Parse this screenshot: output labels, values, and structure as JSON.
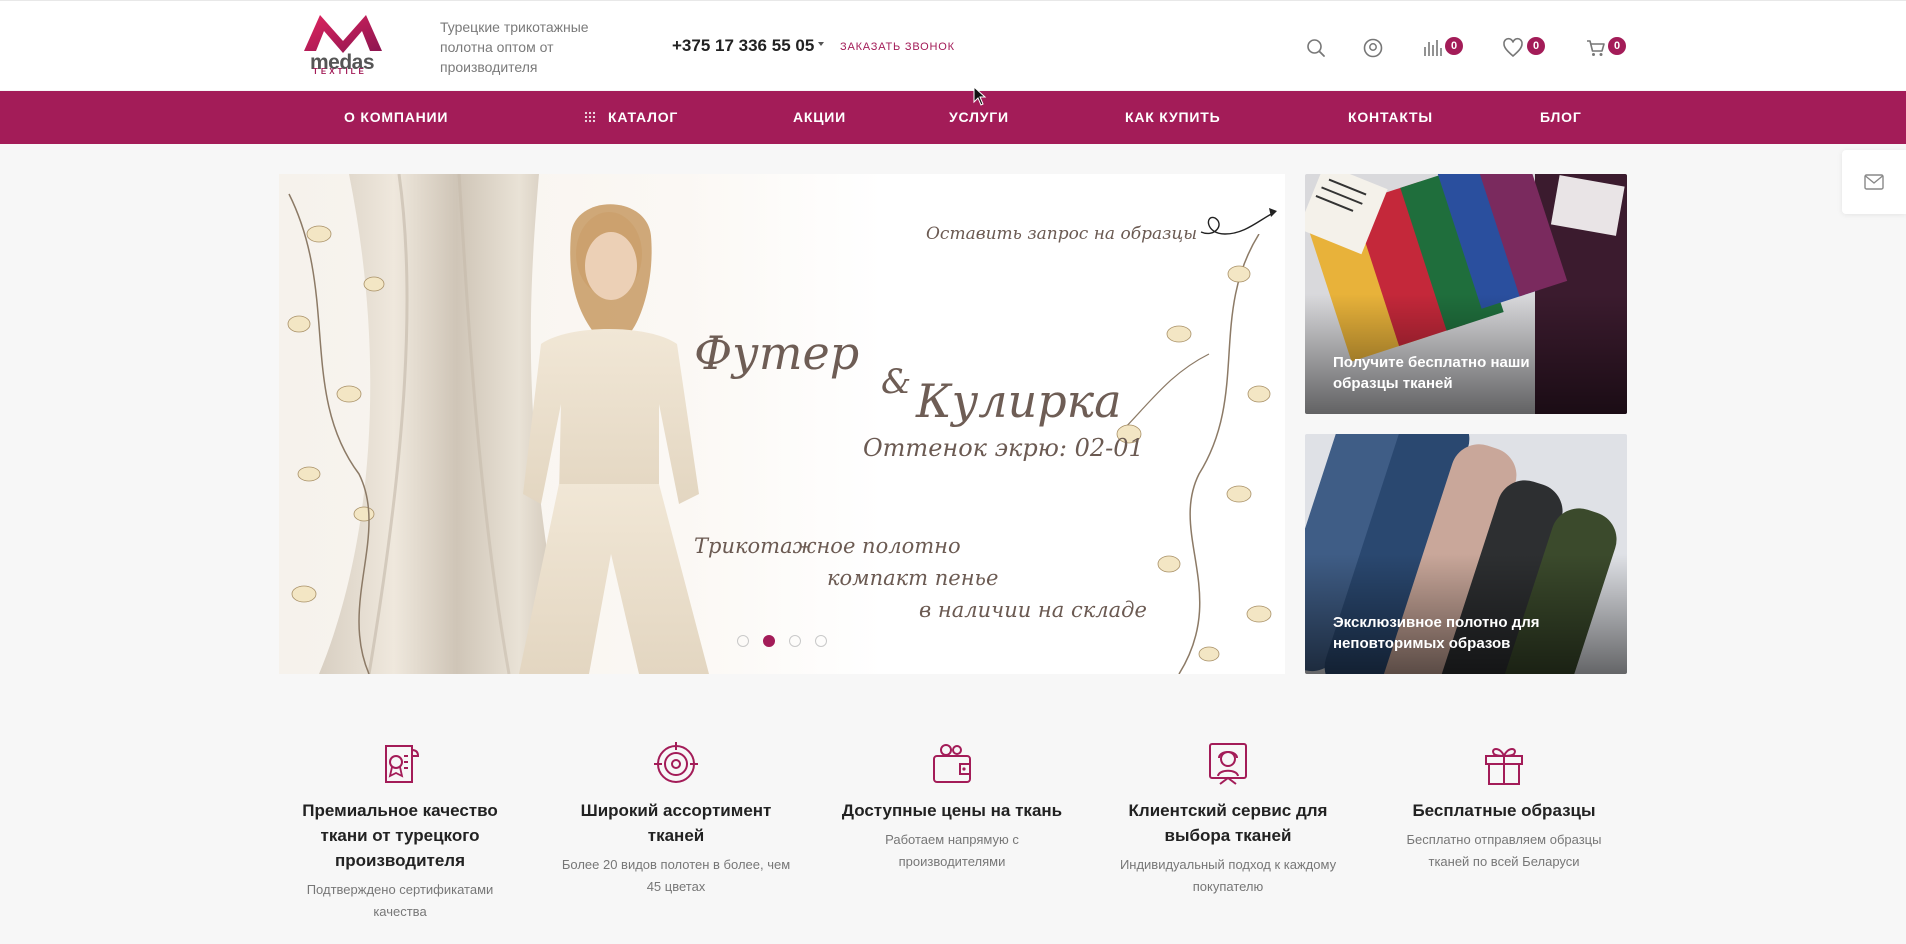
{
  "header": {
    "logo": {
      "word": "medas",
      "sub": "TEXTILE"
    },
    "tagline": "Турецкие трикотажные полотна оптом от производителя",
    "phone": "+375 17 336 55 05",
    "callback": "ЗАКАЗАТЬ ЗВОНОК",
    "icons": [
      "search-icon",
      "user-icon",
      "compare-icon",
      "heart-icon",
      "cart-icon"
    ],
    "compare_count": "0",
    "favorites_count": "0",
    "cart_count": "0"
  },
  "nav": {
    "items": [
      "О КОМПАНИИ",
      "КАТАЛОГ",
      "АКЦИИ",
      "УСЛУГИ",
      "КАК КУПИТЬ",
      "КОНТАКТЫ",
      "БЛОГ"
    ]
  },
  "hero": {
    "request_link": "Оставить запрос на образцы",
    "title_line1": "Футер",
    "title_amp": "&",
    "title_line2": "Кулирка",
    "shade": "Оттенок экрю: 02-01",
    "body_line1": "Трикотажное полотно",
    "body_line2": "компакт пенье",
    "body_line3": "в наличии на складе",
    "slides_total": 4,
    "active_slide": 2
  },
  "cards": [
    {
      "text": "Получите бесплатно наши образцы тканей"
    },
    {
      "text": "Эксклюзивное полотно для неповторимых образов"
    }
  ],
  "features": [
    {
      "icon": "certificate-icon",
      "title": "Премиальное качество ткани от турецкого производителя",
      "desc": "Подтверждено сертификатами качества"
    },
    {
      "icon": "target-icon",
      "title": "Широкий ассортимент тканей",
      "desc": "Более 20 видов полотен в более, чем 45 цветах"
    },
    {
      "icon": "wallet-icon",
      "title": "Доступные цены на ткань",
      "desc": "Работаем напрямую с производителями"
    },
    {
      "icon": "support-icon",
      "title": "Клиентский сервис для выбора тканей",
      "desc": "Индивидуальный подход к каждому покупателю"
    },
    {
      "icon": "gift-icon",
      "title": "Бесплатные образцы",
      "desc": "Бесплатно отправляем образцы тканей по всей Беларуси"
    }
  ],
  "colors": {
    "accent": "#a31c58",
    "background": "#f7f7f7",
    "text": "#222222",
    "muted": "#777777"
  }
}
